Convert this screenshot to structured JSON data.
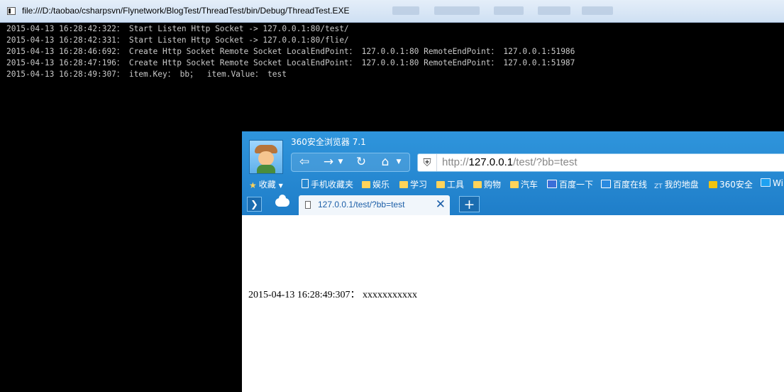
{
  "console": {
    "title": "file:///D:/taobao/csharpsvn/Flynetwork/BlogTest/ThreadTest/bin/Debug/ThreadTest.EXE",
    "lines": [
      "2015-04-13 16:28:42:322： Start Listen Http Socket -> 127.0.0.1:80/test/",
      "2015-04-13 16:28:42:331： Start Listen Http Socket -> 127.0.0.1:80/flie/",
      "2015-04-13 16:28:46:692： Create Http Socket Remote Socket LocalEndPoint： 127.0.0.1:80 RemoteEndPoint： 127.0.0.1:51986",
      "2015-04-13 16:28:47:196： Create Http Socket Remote Socket LocalEndPoint： 127.0.0.1:80 RemoteEndPoint： 127.0.0.1:51987",
      "2015-04-13 16:28:49:307： item.Key： bb；  item.Value： test"
    ]
  },
  "browser": {
    "title": "360安全浏览器 7.1",
    "nav": {
      "back_icon": "back-icon",
      "forward_icon": "forward-icon",
      "refresh_icon": "refresh-icon",
      "home_icon": "home-icon"
    },
    "url": {
      "scheme": "http://",
      "host": "127.0.0.1",
      "path": "/test/?bb=test"
    },
    "favorites": {
      "label": "收藏",
      "items": [
        "手机收藏夹",
        "娱乐",
        "学习",
        "工具",
        "购物",
        "汽车",
        "百度一下",
        "百度在线",
        "我的地盘",
        "360安全",
        "Wi"
      ]
    },
    "tab": {
      "label": "127.0.0.1/test/?bb=test",
      "close": "✕",
      "new_tab": "+"
    },
    "page_text": "2015-04-13 16:28:49:307： xxxxxxxxxxx"
  },
  "colors": {
    "console_bg": "#000000",
    "console_text": "#c8c8c8",
    "browser_chrome": "#2a8fd8",
    "tab_text": "#1d5fa8"
  }
}
